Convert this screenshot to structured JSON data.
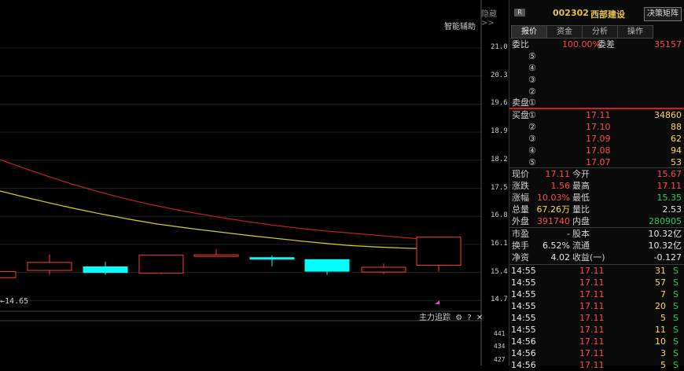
{
  "chart": {
    "toggle_label": "隐藏>>",
    "smart_assist_label": "智能辅助",
    "y_ticks": [
      "21.0",
      "20.3",
      "19.6",
      "18.9",
      "18.2",
      "17.5",
      "16.8",
      "16.1",
      "15.4",
      "14.7"
    ],
    "min_price_label": "14.65",
    "volume_toolbar": {
      "label": "主力追踪",
      "icons": [
        "gear-icon",
        "help-icon",
        "close-icon"
      ],
      "help": "?",
      "close": "✕",
      "gear": "⚙"
    },
    "volume_ticks": [
      "441",
      "434",
      "427"
    ],
    "candles": [
      {
        "open": 15.27,
        "close": 15.42,
        "high": 15.42,
        "low": 15.27,
        "color": "red"
      },
      {
        "open": 15.45,
        "close": 15.65,
        "high": 15.85,
        "low": 15.34,
        "color": "red"
      },
      {
        "open": 15.54,
        "close": 15.4,
        "high": 15.67,
        "low": 15.34,
        "color": "cyan"
      },
      {
        "open": 15.38,
        "close": 15.83,
        "high": 15.84,
        "low": 15.36,
        "color": "red"
      },
      {
        "open": 15.81,
        "close": 15.84,
        "high": 15.98,
        "low": 15.81,
        "color": "red"
      },
      {
        "open": 15.77,
        "close": 15.74,
        "high": 15.82,
        "low": 15.55,
        "color": "cyan"
      },
      {
        "open": 15.72,
        "close": 15.43,
        "high": 15.72,
        "low": 15.34,
        "color": "cyan"
      },
      {
        "open": 15.41,
        "close": 15.53,
        "high": 15.62,
        "low": 15.36,
        "color": "red"
      },
      {
        "open": 15.58,
        "close": 16.28,
        "high": 16.28,
        "low": 15.42,
        "color": "red"
      }
    ]
  },
  "header": {
    "badge": "R",
    "code": "002302",
    "name": "西部建设",
    "decision_button": "决策矩阵"
  },
  "tabs": [
    "报价",
    "资金",
    "分析",
    "操作"
  ],
  "order_ratio": {
    "label": "委比",
    "value": "100.00%",
    "diff_label": "委差",
    "diff_value": "35157"
  },
  "sell": {
    "levels": [
      "⑤",
      "④",
      "③",
      "②",
      "①"
    ],
    "label": "卖盘"
  },
  "buy": {
    "label": "买盘",
    "levels": [
      {
        "mark": "①",
        "price": "17.11",
        "vol": "34860"
      },
      {
        "mark": "②",
        "price": "17.10",
        "vol": "88"
      },
      {
        "mark": "③",
        "price": "17.09",
        "vol": "62"
      },
      {
        "mark": "④",
        "price": "17.08",
        "vol": "94"
      },
      {
        "mark": "⑤",
        "price": "17.07",
        "vol": "53"
      }
    ]
  },
  "stats": [
    {
      "l1": "现价",
      "v1": "17.11",
      "l2": "今开",
      "v2": "15.67",
      "c1": "red",
      "c2": "red"
    },
    {
      "l1": "涨跌",
      "v1": "1.56",
      "l2": "最高",
      "v2": "17.11",
      "c1": "red",
      "c2": "red"
    },
    {
      "l1": "涨幅",
      "v1": "10.03%",
      "l2": "最低",
      "v2": "15.35",
      "c1": "red",
      "c2": "grn"
    },
    {
      "l1": "总量",
      "v1": "67.26万",
      "l2": "量比",
      "v2": "2.53",
      "c1": "yel",
      "c2": "wht"
    },
    {
      "l1": "外盘",
      "v1": "391740",
      "l2": "内盘",
      "v2": "280905",
      "c1": "red",
      "c2": "grn"
    }
  ],
  "fundamentals": [
    {
      "l1": "市盈",
      "v1": "-",
      "l2": "股本",
      "v2": "10.32亿"
    },
    {
      "l1": "换手",
      "v1": "6.52%",
      "l2": "流通",
      "v2": "10.32亿"
    },
    {
      "l1": "净资",
      "v1": "4.02",
      "l2": "收益(一)",
      "v2": "-0.127"
    }
  ],
  "ticks": [
    {
      "time": "14:55",
      "price": "17.11",
      "vol": "31",
      "side": "S"
    },
    {
      "time": "14:55",
      "price": "17.11",
      "vol": "57",
      "side": "S"
    },
    {
      "time": "14:55",
      "price": "17.11",
      "vol": "7",
      "side": "S"
    },
    {
      "time": "14:55",
      "price": "17.11",
      "vol": "20",
      "side": "S"
    },
    {
      "time": "14:55",
      "price": "17.11",
      "vol": "5",
      "side": "S"
    },
    {
      "time": "14:55",
      "price": "17.11",
      "vol": "11",
      "side": "S"
    },
    {
      "time": "14:56",
      "price": "17.11",
      "vol": "10",
      "side": "S"
    },
    {
      "time": "14:56",
      "price": "17.11",
      "vol": "3",
      "side": "S"
    },
    {
      "time": "14:56",
      "price": "17.11",
      "vol": "5",
      "side": "S"
    }
  ],
  "colors": {
    "up": "#ff3b3b",
    "down": "#00ffff",
    "ma_red": "#c0201e",
    "ma_yellow": "#d8d020"
  }
}
